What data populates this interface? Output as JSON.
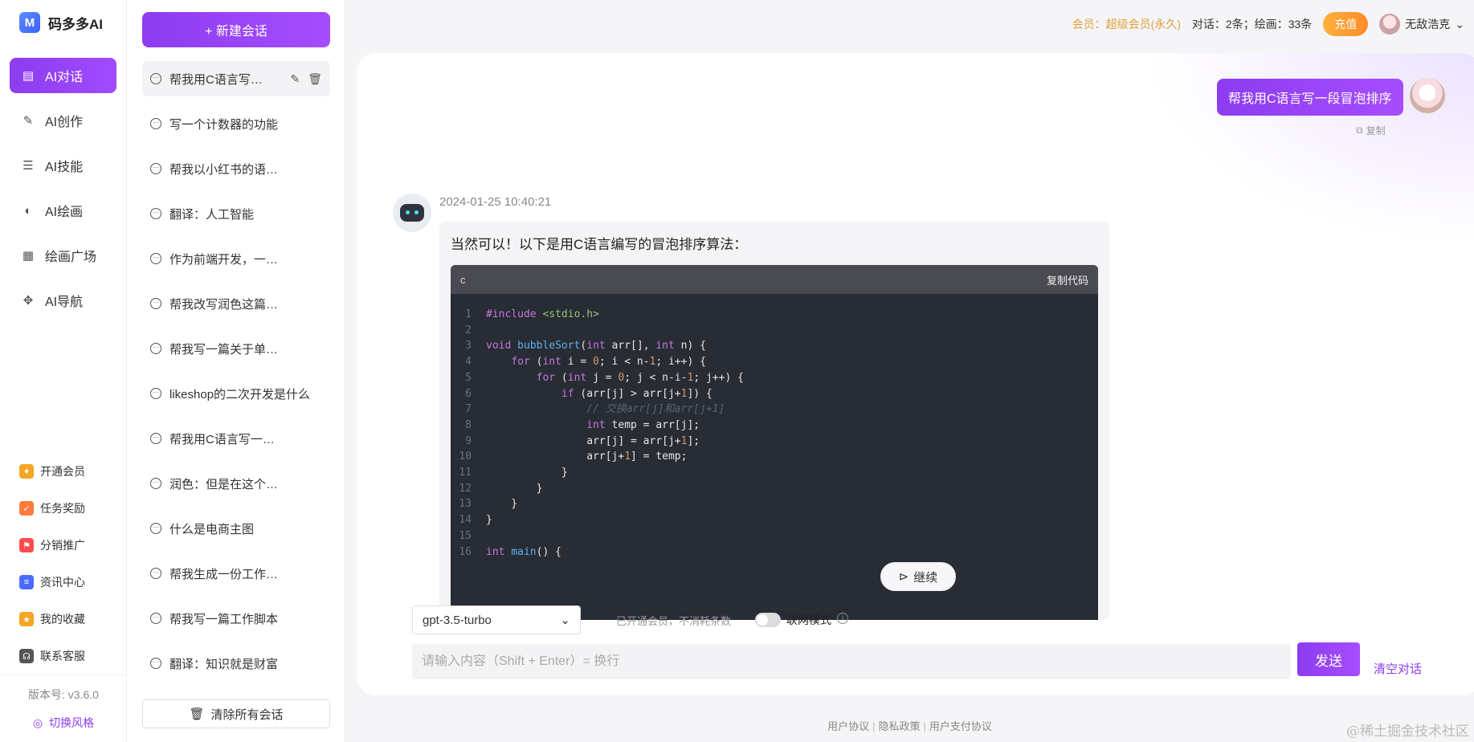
{
  "app": {
    "name": "码多多AI",
    "logo_letter": "M"
  },
  "nav": {
    "items": [
      {
        "label": "AI对话",
        "icon": "chat-icon",
        "glyph": "▤",
        "active": true
      },
      {
        "label": "AI创作",
        "icon": "pen-icon",
        "glyph": "✎",
        "active": false
      },
      {
        "label": "AI技能",
        "icon": "list-icon",
        "glyph": "☰",
        "active": false
      },
      {
        "label": "AI绘画",
        "icon": "palette-icon",
        "glyph": "◐",
        "active": false
      },
      {
        "label": "绘画广场",
        "icon": "image-icon",
        "glyph": "▦",
        "active": false
      },
      {
        "label": "AI导航",
        "icon": "grid-icon",
        "glyph": "✥",
        "active": false
      }
    ],
    "sub_items": [
      {
        "label": "开通会员",
        "icon": "vip-icon",
        "glyph": "♦",
        "color": "#f5a623"
      },
      {
        "label": "任务奖励",
        "icon": "task-icon",
        "glyph": "✓",
        "color": "#ff7a3d"
      },
      {
        "label": "分销推广",
        "icon": "share-icon",
        "glyph": "⚑",
        "color": "#ff4d4f"
      },
      {
        "label": "资讯中心",
        "icon": "news-icon",
        "glyph": "≡",
        "color": "#4b6bff"
      },
      {
        "label": "我的收藏",
        "icon": "star-icon",
        "glyph": "★",
        "color": "#f5a623"
      },
      {
        "label": "联系客服",
        "icon": "headset-icon",
        "glyph": "☊",
        "color": "#555555"
      }
    ],
    "version": "版本号: v3.6.0",
    "theme_switch": "切换风格"
  },
  "conversations": {
    "new_label": "+ 新建会话",
    "items": [
      {
        "title": "帮我用C语言写一段冒泡排序"
      },
      {
        "title": "写一个计数器的功能"
      },
      {
        "title": "帮我以小红书的语气写一篇文案"
      },
      {
        "title": "翻译：人工智能"
      },
      {
        "title": "作为前端开发，一早就开始写代码"
      },
      {
        "title": "帮我改写润色这篇文案\"..."
      },
      {
        "title": "帮我写一篇关于单商户商城的介绍"
      },
      {
        "title": "likeshop的二次开发是什么"
      },
      {
        "title": "帮我用C语言写一段冒泡排序"
      },
      {
        "title": "润色：但是在这个互联网时代"
      },
      {
        "title": "什么是电商主图"
      },
      {
        "title": "帮我生成一份工作日报"
      },
      {
        "title": "帮我写一篇工作脚本"
      },
      {
        "title": "翻译：知识就是财富"
      }
    ],
    "clear_label": "清除所有会话"
  },
  "topbar": {
    "vip": "会员：超级会员(永久)",
    "quota": "对话：2条；绘画：33条",
    "recharge": "充值",
    "username": "无敌浩克"
  },
  "chat": {
    "user_message": "帮我用C语言写一段冒泡排序",
    "copy_label": "复制",
    "timestamp": "2024-01-25 10:40:21",
    "bot_intro": "当然可以！以下是用C语言编写的冒泡排序算法：",
    "code_lang": "c",
    "code_copy": "复制代码",
    "code_lines": [
      "#include <stdio.h>",
      "",
      "void bubbleSort(int arr[], int n) {",
      "    for (int i = 0; i < n-1; i++) {",
      "        for (int j = 0; j < n-i-1; j++) {",
      "            if (arr[j] > arr[j+1]) {",
      "                // 交换arr[j]和arr[j+1]",
      "                int temp = arr[j];",
      "                arr[j] = arr[j+1];",
      "                arr[j+1] = temp;",
      "            }",
      "        }",
      "    }",
      "}",
      "",
      "int main() {"
    ],
    "continue_label": "继续"
  },
  "composer": {
    "model": "gpt-3.5-turbo",
    "member_note": "已开通会员，不消耗条数",
    "web_mode": "联网模式",
    "web_mode_on": false,
    "placeholder": "请输入内容（Shift + Enter）= 换行",
    "send": "发送",
    "clear": "清空对话"
  },
  "footer": {
    "links": [
      "用户协议",
      "隐私政策",
      "用户支付协议"
    ]
  },
  "watermark": "@稀土掘金技术社区"
}
